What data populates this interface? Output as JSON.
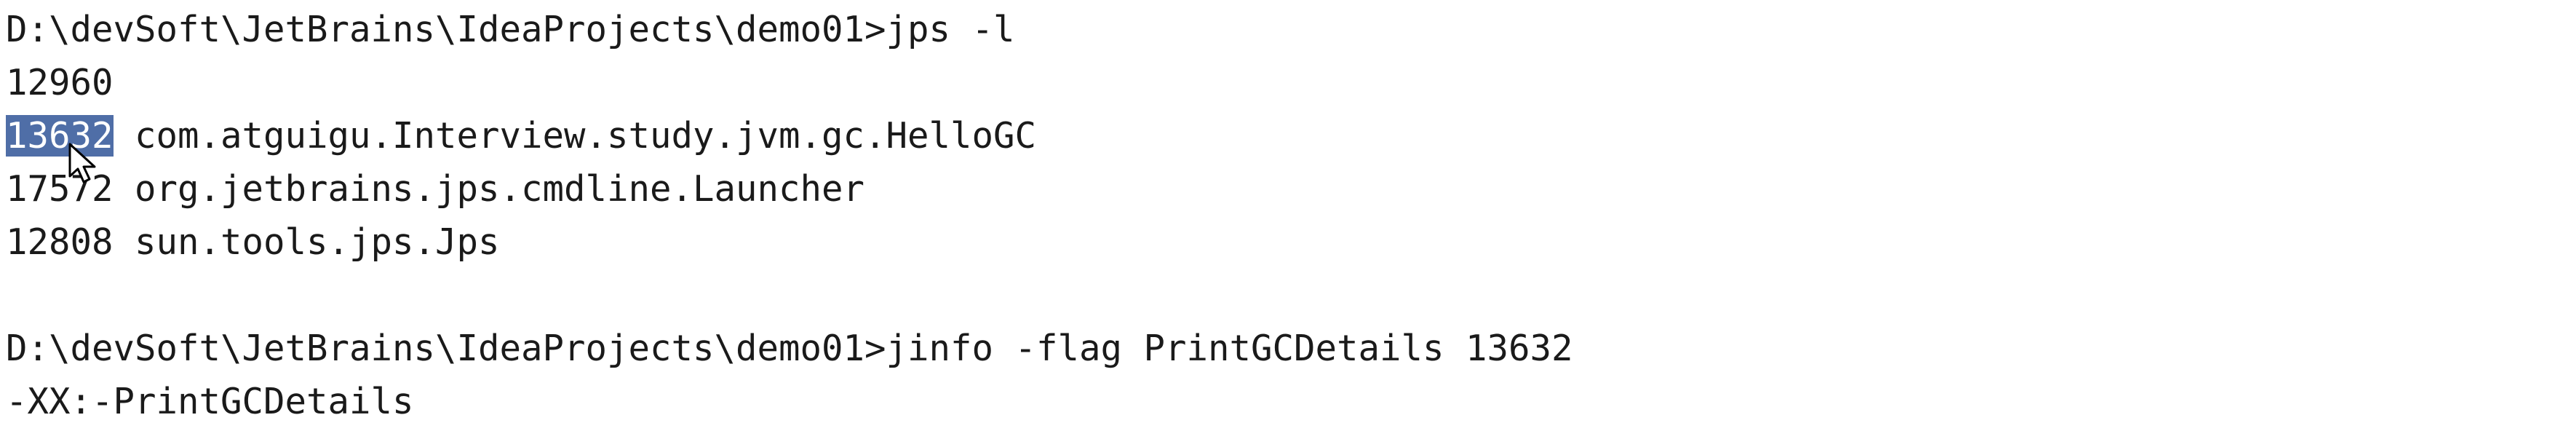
{
  "terminal": {
    "lines": [
      {
        "prompt": "D:\\devSoft\\JetBrains\\IdeaProjects\\demo01>",
        "command": "jps -l"
      },
      {
        "text": "12960"
      },
      {
        "pid": "13632",
        "name": " com.atguigu.Interview.study.jvm.gc.HelloGC",
        "selected_pid": true
      },
      {
        "text": "17572 org.jetbrains.jps.cmdline.Launcher"
      },
      {
        "text": "12808 sun.tools.jps.Jps"
      },
      {
        "text": ""
      },
      {
        "prompt": "D:\\devSoft\\JetBrains\\IdeaProjects\\demo01>",
        "command": "jinfo -flag PrintGCDetails 13632"
      },
      {
        "text": "-XX:-PrintGCDetails"
      }
    ]
  },
  "colors": {
    "background": "#ffffff",
    "text": "#1a1a1a",
    "selection": "#4f6ea7"
  },
  "icons": {
    "cursor": "mouse-pointer-icon"
  }
}
